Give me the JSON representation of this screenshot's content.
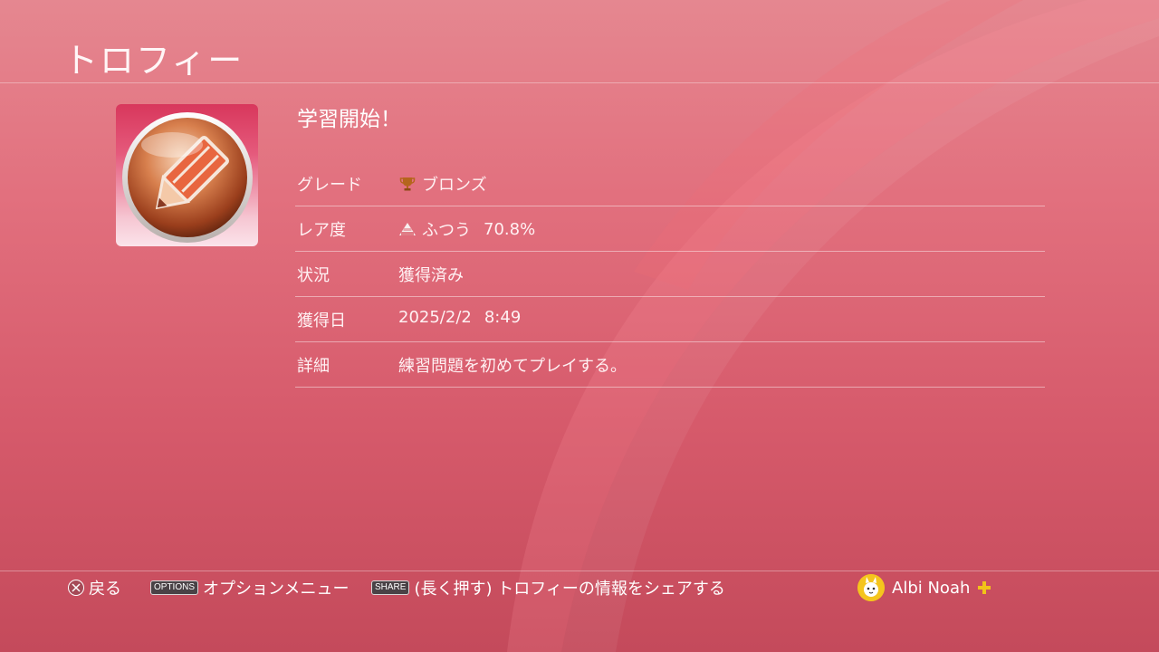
{
  "header": {
    "title": "トロフィー"
  },
  "trophy": {
    "name": "学習開始！",
    "icon": "pencil-orb-icon",
    "details": [
      {
        "label": "グレード",
        "value": "ブロンズ",
        "icon": "bronze-trophy-icon"
      },
      {
        "label": "レア度",
        "value": "ふつう",
        "extra": "70.8%",
        "icon": "rarity-pyramid-icon"
      },
      {
        "label": "状況",
        "value": "獲得済み"
      },
      {
        "label": "獲得日",
        "value": "2025/2/2",
        "extra": "8:49"
      },
      {
        "label": "詳細",
        "value": "練習問題を初めてプレイする。"
      }
    ]
  },
  "footer": {
    "back": {
      "icon": "cross-button-icon",
      "label": "戻る"
    },
    "options": {
      "key": "OPTIONS",
      "label": "オプションメニュー"
    },
    "share": {
      "key": "SHARE",
      "label": "(長く押す) トロフィーの情報をシェアする"
    },
    "user": {
      "name": "Albi Noah",
      "avatar": "avatar-icon",
      "badge": "ps-plus-icon"
    }
  },
  "colors": {
    "background_top": "#e58790",
    "background_bottom": "#c44a5b",
    "plus_badge": "#f2c318",
    "bronze": "#b5651d"
  }
}
